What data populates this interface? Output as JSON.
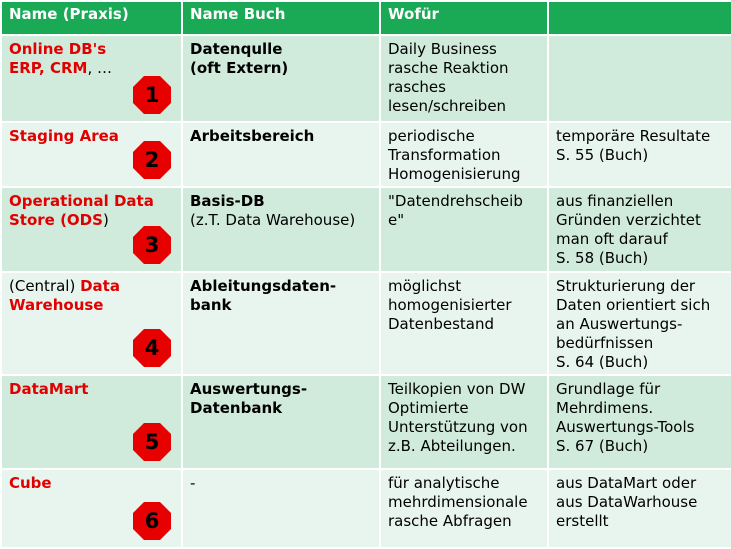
{
  "headers": [
    "Name (Praxis)",
    "Name Buch",
    "Wofür",
    ""
  ],
  "accent_colors": {
    "header_bg": "#1aaa55",
    "row_dark": "#d0ebdc",
    "row_light": "#e8f5ee",
    "red_text": "#e00000",
    "badge": "#e60000"
  },
  "badge_icon": "red-octagon",
  "rows": [
    {
      "praxis_lines": [
        {
          "parts": [
            {
              "t": "Online DB's",
              "style": "red"
            }
          ]
        },
        {
          "parts": [
            {
              "t": "ERP, CRM",
              "style": "red"
            },
            {
              "t": ", …",
              "style": "plain"
            }
          ]
        }
      ],
      "badge": "1",
      "buch_lines": [
        {
          "t": "Datenqulle",
          "style": "bold"
        },
        {
          "t": "(oft Extern)",
          "style": "bold"
        }
      ],
      "wofuer_lines": [
        "Daily Business",
        "rasche Reaktion",
        "rasches",
        "lesen/schreiben"
      ],
      "notes_lines": []
    },
    {
      "praxis_lines": [
        {
          "parts": [
            {
              "t": "Staging Area",
              "style": "red"
            }
          ]
        }
      ],
      "badge": "2",
      "buch_lines": [
        {
          "t": "Arbeitsbereich",
          "style": "bold"
        }
      ],
      "wofuer_lines": [
        "periodische",
        "Transformation",
        "Homogenisierung"
      ],
      "notes_lines": [
        "temporäre Resultate",
        "S. 55 (Buch)"
      ]
    },
    {
      "praxis_lines": [
        {
          "parts": [
            {
              "t": "Operational Data",
              "style": "red"
            }
          ]
        },
        {
          "parts": [
            {
              "t": "Store (ODS",
              "style": "red"
            },
            {
              "t": ")",
              "style": "plain"
            }
          ]
        }
      ],
      "badge": "3",
      "buch_lines": [
        {
          "t": "Basis-DB",
          "style": "bold"
        },
        {
          "t": "(z.T. Data Warehouse)",
          "style": "plain"
        }
      ],
      "wofuer_lines": [
        "\"Datendrehscheib",
        "e\""
      ],
      "notes_lines": [
        "aus finanziellen",
        "Gründen verzichtet",
        "man oft darauf",
        "S. 58 (Buch)"
      ]
    },
    {
      "praxis_lines": [
        {
          "parts": [
            {
              "t": "(Central) ",
              "style": "plain"
            },
            {
              "t": "Data",
              "style": "red"
            }
          ]
        },
        {
          "parts": [
            {
              "t": "Warehouse",
              "style": "red"
            }
          ]
        }
      ],
      "badge": "4",
      "buch_lines": [
        {
          "t": "Ableitungsdaten-",
          "style": "bold"
        },
        {
          "t": "bank",
          "style": "bold"
        }
      ],
      "wofuer_lines": [
        "möglichst",
        "homogenisierter",
        "Datenbestand"
      ],
      "notes_lines": [
        "Strukturierung der",
        "Daten orientiert sich",
        "an Auswertungs-",
        "bedürfnissen",
        "S. 64 (Buch)"
      ]
    },
    {
      "praxis_lines": [
        {
          "parts": [
            {
              "t": "DataMart",
              "style": "red"
            }
          ]
        }
      ],
      "badge": "5",
      "buch_lines": [
        {
          "t": "Auswertungs-",
          "style": "bold"
        },
        {
          "t": "Datenbank",
          "style": "bold"
        }
      ],
      "wofuer_lines": [
        "Teilkopien von DW",
        "Optimierte",
        "Unterstützung von",
        "z.B. Abteilungen."
      ],
      "notes_lines": [
        "Grundlage für",
        "Mehrdimens.",
        "Auswertungs-Tools",
        "S. 67 (Buch)"
      ]
    },
    {
      "praxis_lines": [
        {
          "parts": [
            {
              "t": "Cube",
              "style": "red"
            }
          ]
        }
      ],
      "badge": "6",
      "buch_lines": [
        {
          "t": "-",
          "style": "plain"
        }
      ],
      "wofuer_lines": [
        "für analytische",
        "mehrdimensionale",
        "rasche Abfragen"
      ],
      "notes_lines": [
        "aus DataMart oder",
        "aus DataWarhouse",
        "erstellt"
      ]
    }
  ]
}
